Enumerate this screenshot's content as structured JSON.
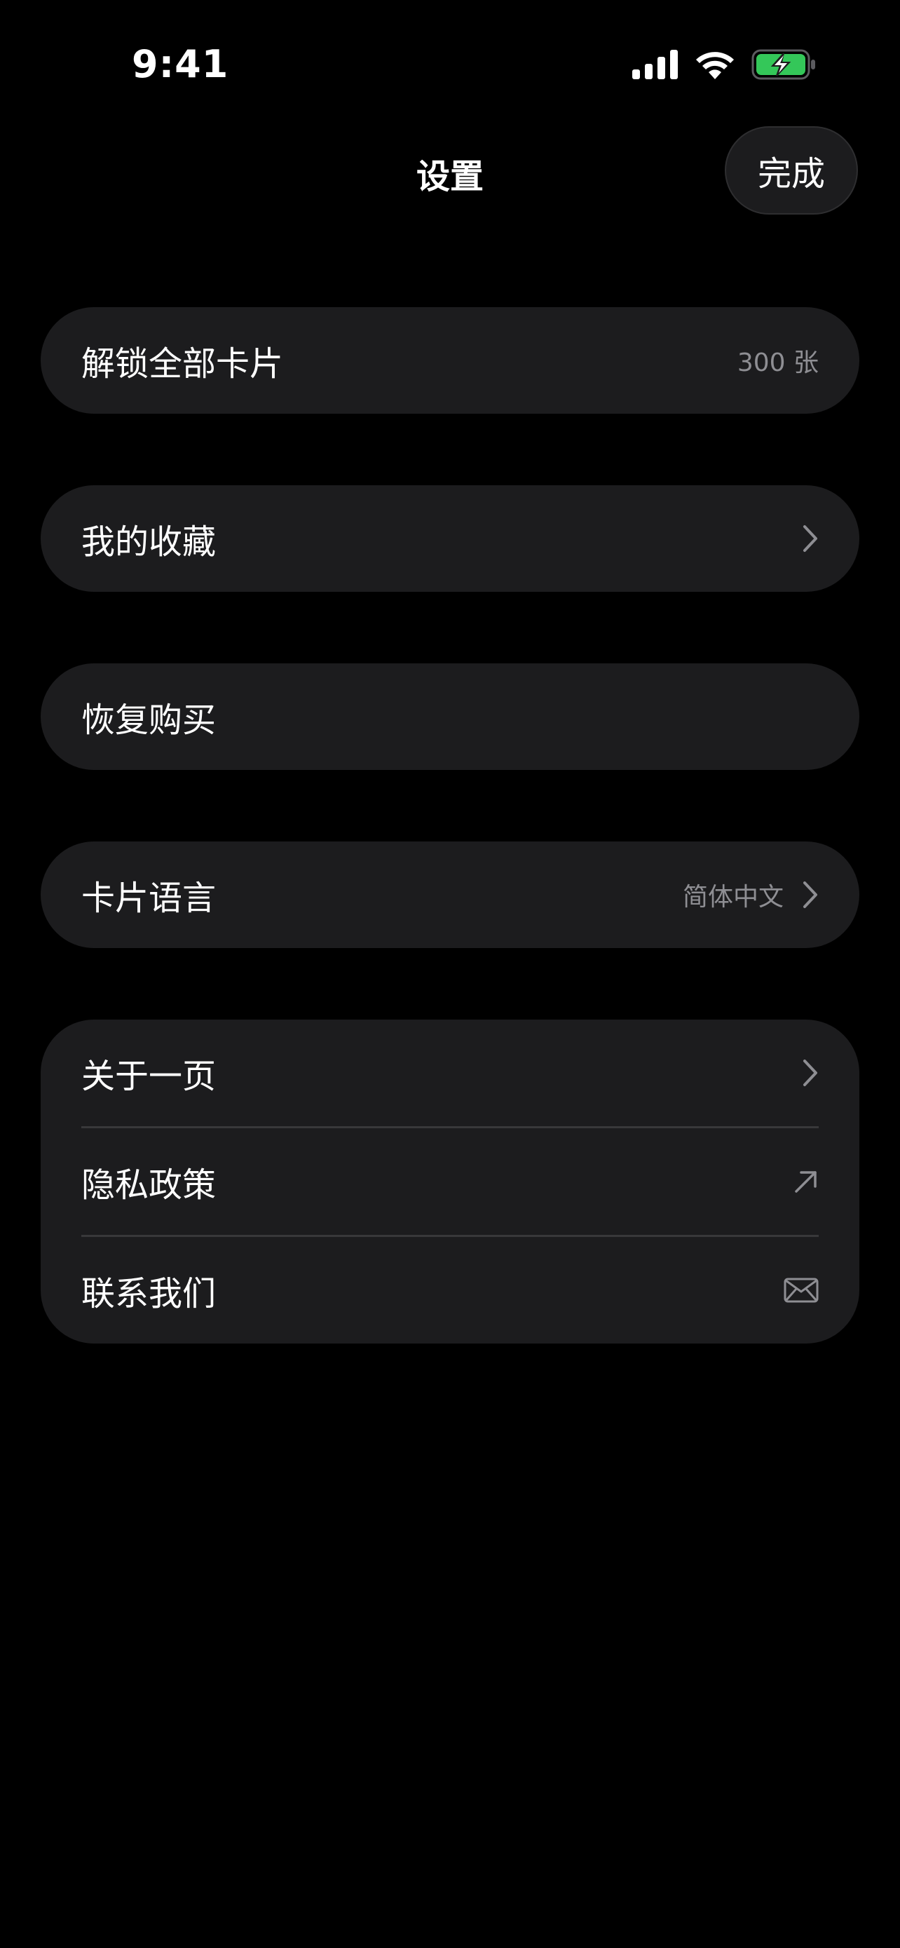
{
  "status_bar": {
    "time": "9:41",
    "icons": [
      "cellular-signal-icon",
      "wifi-icon",
      "battery-charging-icon"
    ],
    "battery_color": "#34c759"
  },
  "nav": {
    "title": "设置",
    "done_label": "完成"
  },
  "settings": {
    "unlock": {
      "label": "解锁全部卡片",
      "value": "300 张"
    },
    "favorites": {
      "label": "我的收藏",
      "icon": "chevron-right-icon"
    },
    "restore": {
      "label": "恢复购买"
    },
    "language": {
      "label": "卡片语言",
      "value": "简体中文",
      "icon": "chevron-right-icon"
    },
    "about": {
      "label": "关于一页",
      "icon": "chevron-right-icon"
    },
    "privacy": {
      "label": "隐私政策",
      "icon": "external-link-arrow-icon"
    },
    "contact": {
      "label": "联系我们",
      "icon": "mail-icon"
    }
  },
  "colors": {
    "background": "#000000",
    "card": "#1c1c1e",
    "secondary_text": "#8e8e93",
    "divider": "#38383a"
  }
}
